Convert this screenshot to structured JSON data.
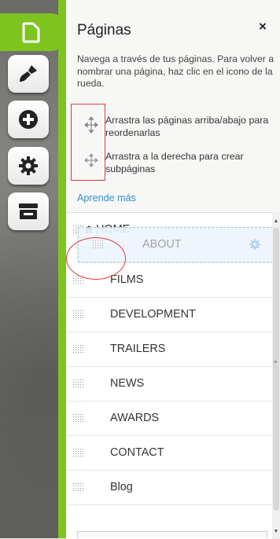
{
  "sidebar": {
    "buttons": [
      {
        "icon": "page-icon",
        "active": true
      },
      {
        "icon": "paintbrush-icon"
      },
      {
        "icon": "plus-circle-icon"
      },
      {
        "icon": "gear-icon"
      },
      {
        "icon": "store-icon"
      }
    ],
    "accent": "#7ec41f"
  },
  "panel": {
    "title": "Páginas",
    "close_label": "×",
    "description": "Navega a través de tus páginas. Para volver a nombrar una página, haz clic en el icono de la rueda.",
    "hints": [
      {
        "icon": "move-arrows-icon",
        "text": "Arrastra las páginas arriba/abajo para reordenarlas"
      },
      {
        "icon": "move-right-icon",
        "text": "Arrastra a la derecha para crear subpáginas"
      }
    ],
    "learn_more": "Aprende más",
    "link_color": "#2f8fcf"
  },
  "pages": [
    {
      "label": "HOME",
      "home": true
    },
    {
      "label": "ABOUT",
      "dragging": true
    },
    {
      "label": "FILMS"
    },
    {
      "label": "DEVELOPMENT"
    },
    {
      "label": "TRAILERS"
    },
    {
      "label": "NEWS"
    },
    {
      "label": "AWARDS"
    },
    {
      "label": "CONTACT"
    },
    {
      "label": "Blog"
    }
  ]
}
